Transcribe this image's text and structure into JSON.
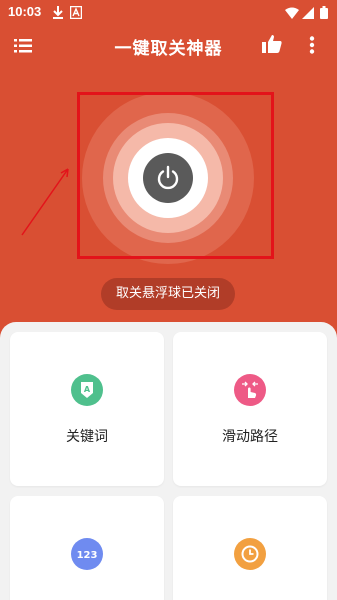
{
  "status_bar": {
    "time": "10:03"
  },
  "app_bar": {
    "title": "一键取关神器"
  },
  "power": {
    "status_text": "取关悬浮球已关闭"
  },
  "features": [
    {
      "label": "关键词",
      "icon": "keyword-icon",
      "color": "#4fc08d"
    },
    {
      "label": "滑动路径",
      "icon": "swipe-path-icon",
      "color": "#ee5a86"
    },
    {
      "label": "",
      "icon": "numbers-icon",
      "color": "#6f8bf0"
    },
    {
      "label": "",
      "icon": "clock-icon",
      "color": "#f2a040"
    }
  ],
  "colors": {
    "primary": "#d94f33",
    "pill": "#b13d28",
    "power_button": "#5a5a5a",
    "highlight": "#e3131a"
  }
}
